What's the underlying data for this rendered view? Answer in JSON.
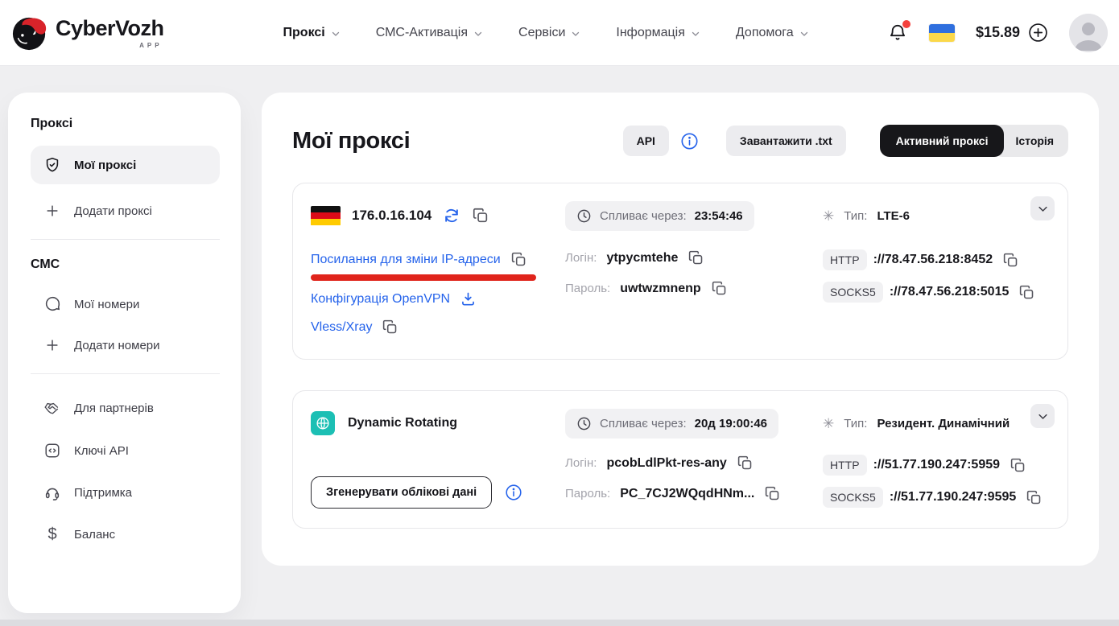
{
  "colors": {
    "accent_blue": "#2563eb",
    "annotation_red": "#e0241b",
    "teal": "#1cbfb4",
    "dark_toggle": "#17171a",
    "page_bg": "#efeff1",
    "flag_ua": [
      "#2f6fde",
      "#fbd84a"
    ],
    "flag_de": [
      "#111111",
      "#dd0b18",
      "#ffcb00"
    ]
  },
  "header": {
    "brand": "CyberVozh",
    "brand_sub": "APP",
    "nav": [
      {
        "label": "Проксі"
      },
      {
        "label": "СМС-Активація"
      },
      {
        "label": "Сервіси"
      },
      {
        "label": "Інформація"
      },
      {
        "label": "Допомога"
      }
    ],
    "balance": "$15.89",
    "icons": [
      "bell-icon",
      "flag-ukraine",
      "plus-circle-icon",
      "avatar"
    ]
  },
  "sidebar": {
    "heading_proxy": "Проксі",
    "my_proxies": "Мої проксі",
    "add_proxy": "Додати проксі",
    "heading_sms": "СМС",
    "my_numbers": "Мої номери",
    "add_numbers": "Додати номери",
    "partners": "Для партнерів",
    "api_keys": "Ключі API",
    "support": "Підтримка",
    "balance": "Баланс"
  },
  "main": {
    "title": "Мої проксі",
    "api_button": "API",
    "download_txt_button": "Завантажити .txt",
    "tab_active": "Активний проксі",
    "tab_history": "Історія",
    "cards": [
      {
        "ip": "176.0.16.104",
        "country_flag": "germany",
        "expires_label": "Спливає через:",
        "expires_value": "23:54:46",
        "type_label": "Тип:",
        "type_value": "LTE-6",
        "link_change_ip": "Посилання для зміни IP-адреси",
        "link_openvpn": "Конфігурація OpenVPN",
        "link_vless": "Vless/Xray",
        "login_label": "Логін:",
        "login_value": "ytpycmtehe",
        "password_label": "Пароль:",
        "password_value": "uwtwzmnenp",
        "http_tag": "HTTP",
        "http_value": "://78.47.56.218:8452",
        "socks_tag": "SOCKS5",
        "socks_value": "://78.47.56.218:5015"
      },
      {
        "name": "Dynamic Rotating",
        "expires_label": "Спливає через:",
        "expires_value": "20д 19:00:46",
        "type_label": "Тип:",
        "type_value": "Резидент. Динамічний",
        "generate_button": "Згенерувати облікові дані",
        "login_label": "Логін:",
        "login_value": "pcobLdlPkt-res-any",
        "password_label": "Пароль:",
        "password_value": "PC_7CJ2WQqdHNm...",
        "http_tag": "HTTP",
        "http_value": "://51.77.190.247:5959",
        "socks_tag": "SOCKS5",
        "socks_value": "://51.77.190.247:9595"
      }
    ]
  }
}
